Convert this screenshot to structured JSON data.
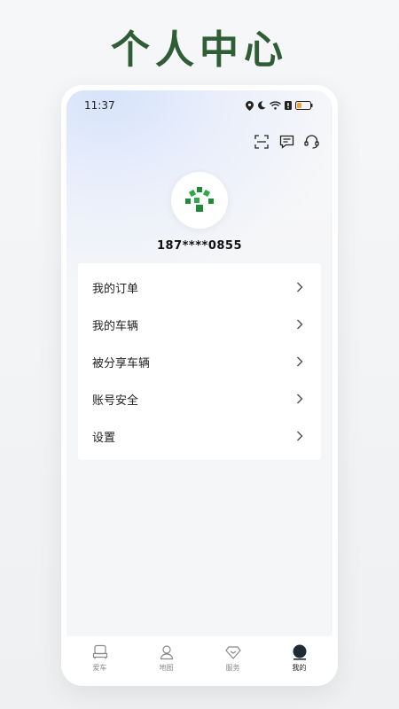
{
  "headline": "个人中心",
  "status_bar": {
    "time": "11:37",
    "battery_color": "#f0a13a"
  },
  "profile": {
    "phone": "187****0855",
    "logo_colors": [
      "#1f8a3c",
      "#2fa84c"
    ]
  },
  "menu": {
    "items": [
      {
        "label": "我的订单"
      },
      {
        "label": "我的车辆"
      },
      {
        "label": "被分享车辆"
      },
      {
        "label": "账号安全"
      },
      {
        "label": "设置"
      }
    ]
  },
  "tabs": [
    {
      "label": "爱车",
      "icon": "car-seat-icon",
      "active": false
    },
    {
      "label": "地图",
      "icon": "map-pin-icon",
      "active": false
    },
    {
      "label": "服务",
      "icon": "diamond-icon",
      "active": false
    },
    {
      "label": "我的",
      "icon": "profile-dot-icon",
      "active": true
    }
  ],
  "colors": {
    "headline": "#2f5d35",
    "accent_dark": "#1e2b34"
  }
}
